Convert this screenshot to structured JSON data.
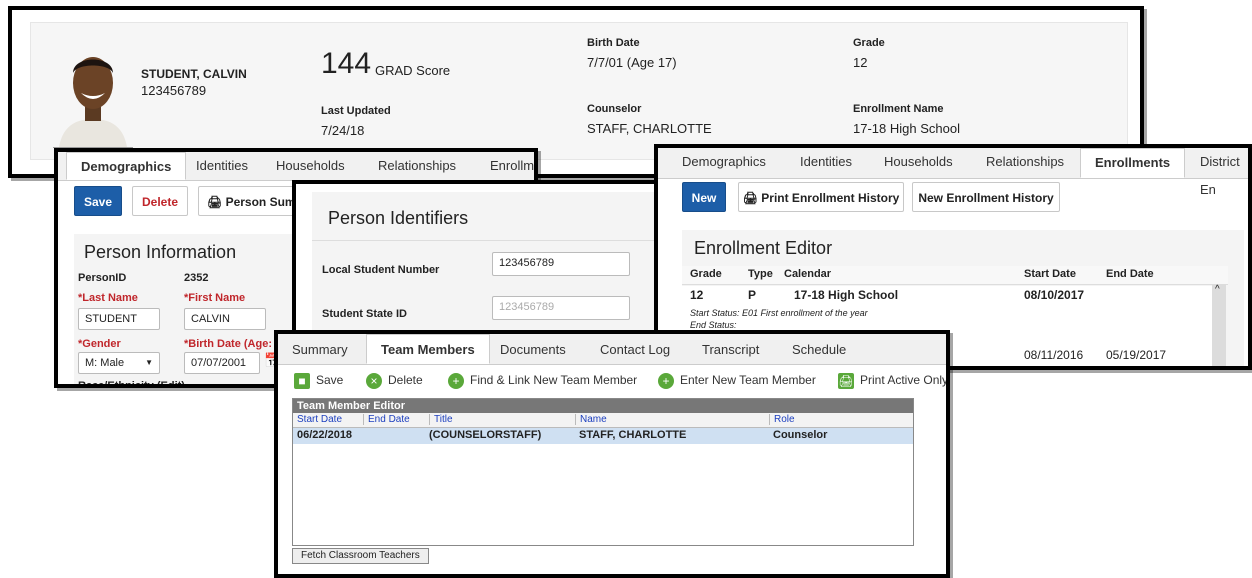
{
  "header": {
    "student_name": "STUDENT, CALVIN",
    "student_id": "123456789",
    "grad_score": "144",
    "grad_score_label": "GRAD Score",
    "last_updated_label": "Last Updated",
    "last_updated": "7/24/18",
    "birth_date_label": "Birth Date",
    "birth_date": "7/7/01 (Age 17)",
    "counselor_label": "Counselor",
    "counselor": "STAFF, CHARLOTTE",
    "grade_label": "Grade",
    "grade": "12",
    "enrollment_name_label": "Enrollment Name",
    "enrollment_name": "17-18 High School"
  },
  "demographics": {
    "tabs": [
      "Demographics",
      "Identities",
      "Households",
      "Relationships",
      "Enrollme"
    ],
    "save": "Save",
    "delete": "Delete",
    "person_summary": "Person Sumr",
    "section_title": "Person Information",
    "personid_label": "PersonID",
    "personid": "2352",
    "last_name_label": "*Last Name",
    "last_name": "STUDENT",
    "first_name_label": "*First Name",
    "first_name": "CALVIN",
    "gender_label": "*Gender",
    "gender": "M: Male",
    "birth_date_label": "*Birth Date (Age: 1",
    "birth_date": "07/07/2001",
    "race_label": "Race/Ethnicity (Edit)"
  },
  "identifiers": {
    "title": "Person Identifiers",
    "local_label": "Local Student Number",
    "local_value": "123456789",
    "state_label": "Student State ID",
    "state_value": "123456789"
  },
  "enrollments": {
    "tabs": [
      "Demographics",
      "Identities",
      "Households",
      "Relationships",
      "Enrollments",
      "District En"
    ],
    "new": "New",
    "print_history": "Print Enrollment History",
    "new_history": "New Enrollment History",
    "editor_title": "Enrollment Editor",
    "columns": [
      "Grade",
      "Type",
      "Calendar",
      "Start Date",
      "End Date"
    ],
    "rows": [
      {
        "grade": "12",
        "type": "P",
        "calendar": "17-18 High School",
        "start": "08/10/2017",
        "end": "",
        "start_status": "Start Status: E01 First enrollment of the year",
        "end_status": "End Status:"
      },
      {
        "grade": "",
        "type": "",
        "calendar": "",
        "start": "08/11/2016",
        "end": "05/19/2017"
      }
    ]
  },
  "team": {
    "tabs": [
      "Summary",
      "Team Members",
      "Documents",
      "Contact Log",
      "Transcript",
      "Schedule"
    ],
    "toolbar": {
      "save": "Save",
      "delete": "Delete",
      "find_link": "Find & Link New Team Member",
      "enter_new": "Enter New Team Member",
      "print_active": "Print Active Only"
    },
    "editor_title": "Team Member Editor",
    "columns": [
      "Start Date",
      "End Date",
      "Title",
      "Name",
      "Role"
    ],
    "rows": [
      {
        "start": "06/22/2018",
        "end": "",
        "title": "(COUNSELORSTAFF)",
        "name": "STAFF, CHARLOTTE",
        "role": "Counselor"
      }
    ],
    "fetch_button": "Fetch Classroom Teachers"
  },
  "colors": {
    "primary": "#1d5ea8",
    "danger": "#c0262b",
    "legacy_header": "#777777",
    "legacy_link": "#1c3fbf",
    "selected_row": "#cfe0f2"
  }
}
